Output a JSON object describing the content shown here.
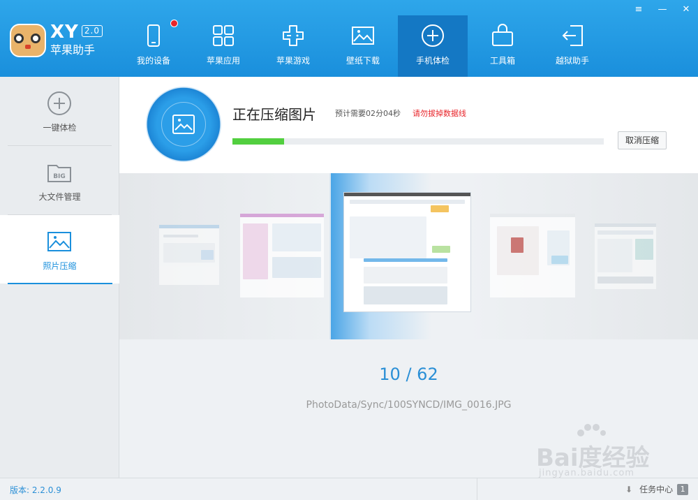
{
  "app": {
    "name_latin": "XY",
    "version_badge": "2.0",
    "name_cn": "苹果助手"
  },
  "window_controls": [
    "≡",
    "—",
    "✕"
  ],
  "nav": [
    {
      "label": "我的设备",
      "icon": "phone-icon",
      "has_dot": true
    },
    {
      "label": "苹果应用",
      "icon": "apps-grid-icon"
    },
    {
      "label": "苹果游戏",
      "icon": "gamepad-icon"
    },
    {
      "label": "壁纸下载",
      "icon": "image-icon"
    },
    {
      "label": "手机体检",
      "icon": "plus-circle-icon",
      "active": true
    },
    {
      "label": "工具箱",
      "icon": "toolbox-icon"
    },
    {
      "label": "越狱助手",
      "icon": "exit-arrow-icon"
    }
  ],
  "sidebar": [
    {
      "label": "一键体检",
      "icon": "plus-circle-icon"
    },
    {
      "label": "大文件管理",
      "icon": "big-folder-icon",
      "icon_text": "BIG"
    },
    {
      "label": "照片压缩",
      "icon": "photo-icon",
      "active": true
    }
  ],
  "panel": {
    "title": "正在压缩图片",
    "eta": "预计需要02分04秒",
    "warning": "请勿拔掉数据线",
    "progress": 0.14,
    "cancel_label": "取消压缩"
  },
  "gallery": {
    "current": "10",
    "total": "62",
    "separator": " / ",
    "file_path": "PhotoData/Sync/100SYNCD/IMG_0016.JPG"
  },
  "status": {
    "version": "版本: 2.2.0.9",
    "task_center": "任务中心",
    "task_count": "1"
  },
  "watermark": {
    "text": "Bai度经验",
    "sub": "jingyan.baidu.com"
  },
  "colors": {
    "brand_blue": "#1a8fdc",
    "progress_green": "#52cf3f",
    "warning_red": "#e8242a"
  }
}
